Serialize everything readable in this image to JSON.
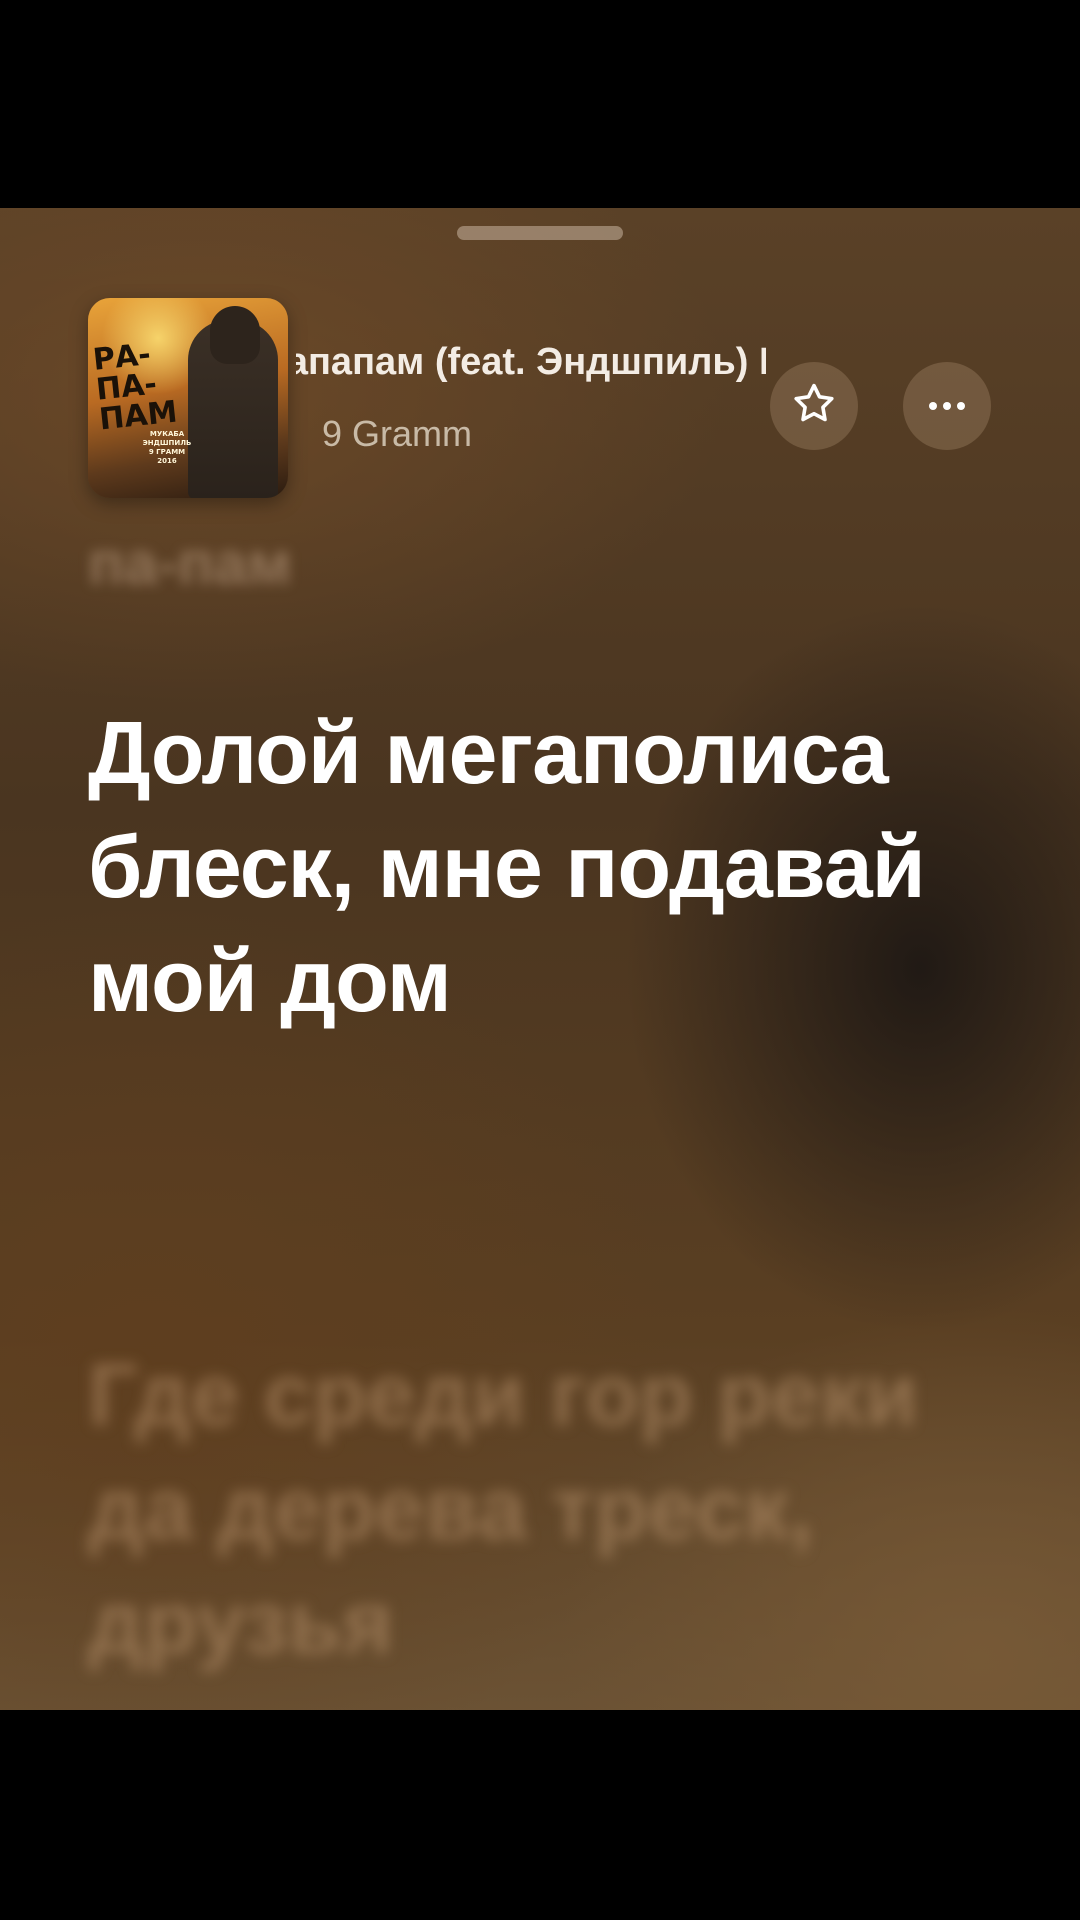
{
  "player": {
    "track_title": "Рапапам (feat. Эндшпиль)      Рапапам",
    "artist": "9 Gramm",
    "cover_art": {
      "title": "РА-ПА-ПАМ",
      "subtitle": "МУКАБА ЭНДШПИЛЬ 9 ГРАММ 2016"
    },
    "lyrics": {
      "previous": "па-пам",
      "current": "Долой мегаполиса блеск, мне подавай мой дом",
      "next": "Где среди гор реки да дерева треск, друзья"
    },
    "icons": {
      "favorite": "star-outline-icon",
      "more": "more-horizontal-icon"
    }
  }
}
